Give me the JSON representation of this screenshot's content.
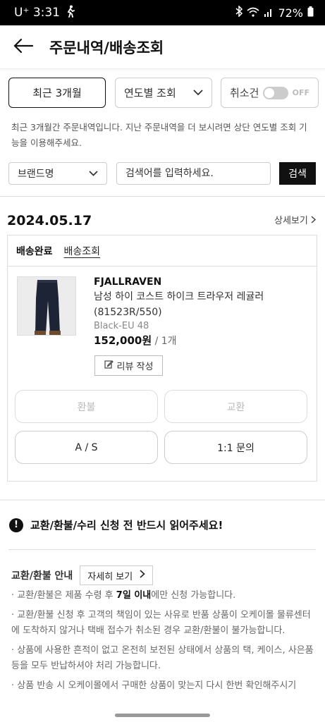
{
  "status_bar": {
    "carrier": "U⁺ 3:31",
    "battery": "72%"
  },
  "header": {
    "title": "주문내역/배송조회"
  },
  "filter": {
    "recent_label": "최근 3개월",
    "year_label": "연도별 조회",
    "cancel_label": "취소건",
    "toggle_state": "OFF"
  },
  "notice": "최근 3개월간 주문내역입니다. 지난 주문내역을 더 보시려면 상단 연도별 조회 기능을 이용해주세요.",
  "search": {
    "brand_label": "브랜드명",
    "placeholder": "검색어를 입력하세요.",
    "button": "검색"
  },
  "order": {
    "date": "2024.05.17",
    "detail_link": "상세보기",
    "status": "배송완료",
    "track_link": "배송조회",
    "brand": "FJALLRAVEN",
    "name": "남성 하이 코스트 하이크 트라우저 레귤러 (81523R/550)",
    "option": "Black-EU 48",
    "price": "152,000원",
    "qty": " / 1개",
    "review_label": "리뷰 작성",
    "actions": {
      "refund": "환불",
      "exchange": "교환",
      "as": "A / S",
      "inquiry": "1:1 문의"
    }
  },
  "warning": "교환/환불/수리 신청 전 반드시 읽어주세요!",
  "guide": {
    "title": "교환/환불 안내",
    "more_label": "자세히 보기",
    "b1_pre": "· 교환/환불은 제품 수령 후 ",
    "b1_bold": "7일 이내",
    "b1_post": "에만 신청 가능합니다.",
    "b2": "· 교환/환불 신청 후 고객의 책임이 있는 사유로 반품 상품이 오케이몰 물류센터에 도착하지 않거나 택배 접수가 취소된 경우 교환/환불이 불가능합니다.",
    "b3": "· 상품에 사용한 흔적이 없고 온전히 보전된 상태에서 상품의 택, 케이스, 사은품 등을 모두 반납하셔야 처리 가능합니다.",
    "b4": "· 상품 반송 시 오케이몰에서 구매한 상품이 맞는지 다시 한번 확인해주시기"
  },
  "colors": {
    "accent": "#111111",
    "border": "#dddddd",
    "muted": "#888888"
  }
}
